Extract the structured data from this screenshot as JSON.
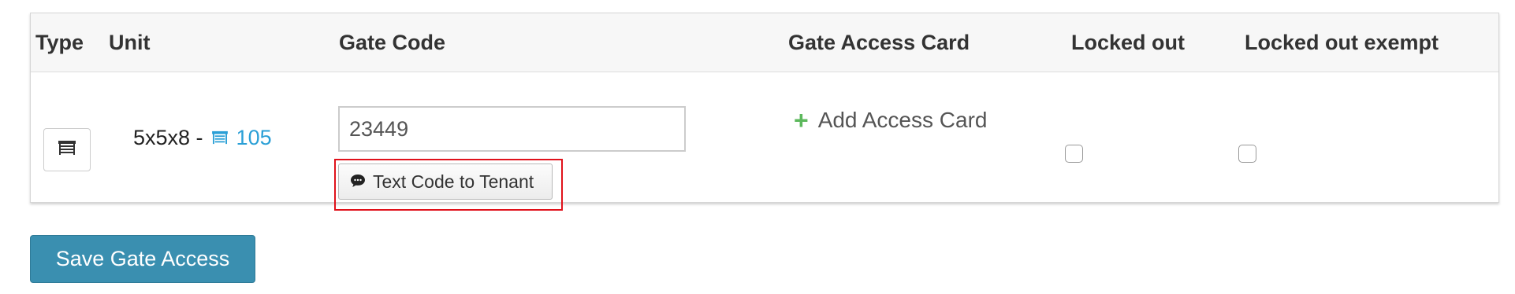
{
  "table": {
    "headers": {
      "type": "Type",
      "unit": "Unit",
      "gate_code": "Gate Code",
      "gate_access_card": "Gate Access Card",
      "locked_out": "Locked out",
      "locked_out_exempt": "Locked out exempt"
    },
    "rows": [
      {
        "type_icon": "unit-type-icon",
        "unit_size": "5x5x8 -",
        "unit_icon": "storage-unit-icon",
        "unit_number": "105",
        "gate_code_value": "23449",
        "text_code_label": "Text Code to Tenant",
        "text_code_icon": "chat-bubble-icon",
        "add_card_icon": "plus-icon",
        "add_card_label": "Add Access Card",
        "locked_out": false,
        "locked_out_exempt": false
      }
    ]
  },
  "actions": {
    "save_label": "Save Gate Access"
  },
  "colors": {
    "link": "#2a9fd6",
    "save_button": "#3a8fb0",
    "add_plus": "#5cb85c",
    "highlight_border": "#e0121b"
  }
}
